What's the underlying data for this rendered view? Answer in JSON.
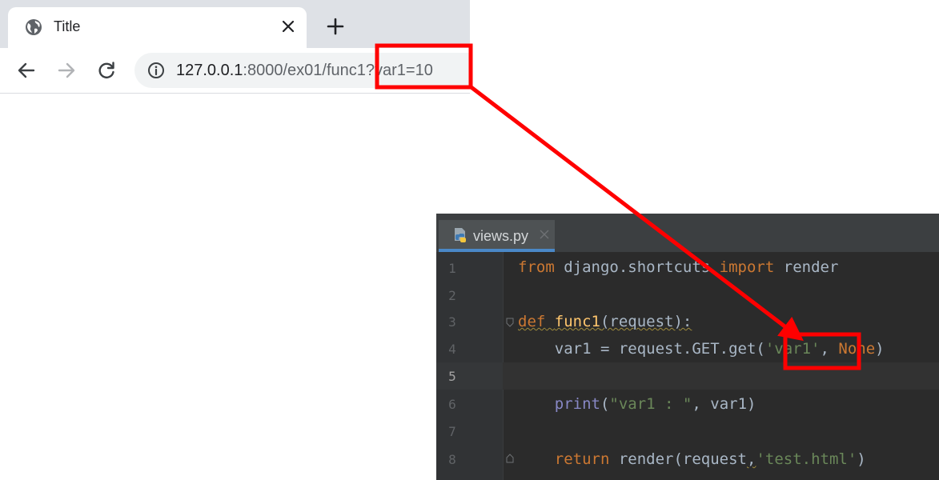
{
  "browser": {
    "tab_title": "Title",
    "url_host": "127.0.0.1",
    "url_rest": ":8000/ex01/func1?var1=10"
  },
  "editor": {
    "file_tab": "views.py",
    "line_numbers": [
      "1",
      "2",
      "3",
      "4",
      "5",
      "6",
      "7",
      "8"
    ],
    "current_line": "5",
    "code": {
      "l1_from": "from",
      "l1_module": " django.shortcuts ",
      "l1_import": "import",
      "l1_name": " render",
      "l3_def": "def",
      "l3_fn": "func1",
      "l3_rest": "(request):",
      "l4_start": "    var1 = request.GET.get(",
      "l4_str": "'var1'",
      "l4_comma": ", ",
      "l4_none": "None",
      "l4_end": ")",
      "l6_print": "print",
      "l6_open": "(",
      "l6_str": "\"var1 : \"",
      "l6_rest": ", var1)",
      "l8_return": "return",
      "l8_mid": " render(request",
      "l8_comma": ",",
      "l8_str": "'test.html'",
      "l8_end": ")"
    }
  },
  "colors": {
    "highlight": "#ff0000",
    "keyword": "#cc7832",
    "function": "#ffc66d",
    "string": "#6a8759",
    "builtin": "#8888c6",
    "text": "#a9b7c6",
    "editor_bg": "#2b2b2b"
  },
  "icons": {
    "favicon": "globe-icon",
    "tab_close": "close-icon",
    "new_tab": "plus-icon",
    "back": "arrow-left-icon",
    "forward": "arrow-right-icon",
    "reload": "reload-icon",
    "site_info": "info-icon",
    "file_type": "python-file-icon"
  }
}
